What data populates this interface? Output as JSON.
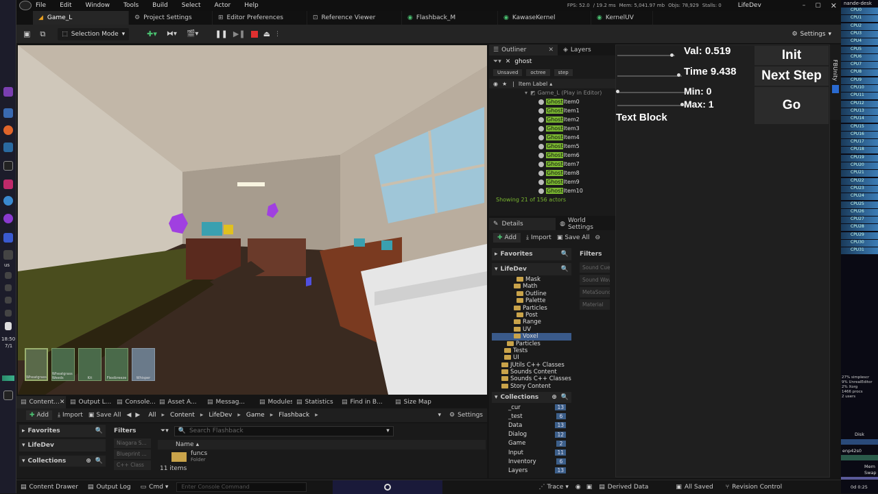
{
  "menu": {
    "items": [
      "File",
      "Edit",
      "Window",
      "Tools",
      "Build",
      "Select",
      "Actor",
      "Help"
    ],
    "stats": {
      "fps": "FPS: 52.0",
      "ms": "/ 19.2 ms",
      "mem": "Mem: 5,041.97 mb",
      "objs": "Objs: 78,929",
      "stalls": "Stalls: 0"
    },
    "project": "LifeDev"
  },
  "tabs": [
    "Game_L",
    "Project Settings",
    "Editor Preferences",
    "Reference Viewer",
    "Flashback_M",
    "KawaseKernel",
    "KernelUV"
  ],
  "toolbar": {
    "selection_mode": "Selection Mode",
    "settings": "Settings"
  },
  "viewport": {
    "inventory_labels": [
      "Wheatgrass",
      "Wheatgrass Weeds",
      "Kit",
      "Flexibreeze",
      "Whisper"
    ]
  },
  "outliner": {
    "title": "Outliner",
    "layers_tab": "Layers",
    "search_value": "ghost",
    "filter_chips": [
      "Unsaved",
      "octree",
      "step"
    ],
    "column": "Item Label",
    "root": "Game_L (Play in Editor)",
    "highlight": "Ghost",
    "items": [
      "Item0",
      "Item1",
      "Item2",
      "Item3",
      "Item4",
      "Item5",
      "Item6",
      "Item7",
      "Item8",
      "Item9",
      "Item10"
    ],
    "status": "Showing 21 of 156 actors"
  },
  "details": {
    "title": "Details",
    "world_settings": "World Settings",
    "add": "Add",
    "import": "Import",
    "save_all": "Save All",
    "favorites": "Favorites",
    "lifedev": "LifeDev",
    "filters": "Filters",
    "filter_items": [
      "Sound Cue",
      "Sound Wave",
      "MetaSound",
      "Material"
    ],
    "folders": [
      "Mask",
      "Math",
      "Outline",
      "Palette",
      "Particles",
      "Post",
      "Range",
      "UV",
      "Voxel",
      "Particles",
      "Tests",
      "UI",
      "JUtils C++ Classes",
      "Sounds Content",
      "Sounds C++ Classes",
      "Story Content"
    ],
    "collections_title": "Collections",
    "collections": [
      {
        "name": "_cur",
        "count": "13"
      },
      {
        "name": "_test",
        "count": "6"
      },
      {
        "name": "Data",
        "count": "13"
      },
      {
        "name": "Dialog",
        "count": "12"
      },
      {
        "name": "Game",
        "count": "2"
      },
      {
        "name": "Input",
        "count": "11"
      },
      {
        "name": "Inventory",
        "count": "6"
      },
      {
        "name": "Layers",
        "count": "13"
      }
    ]
  },
  "widget": {
    "val": "Val: 0.519",
    "time": "Time 9.438",
    "min": "Min: 0",
    "max": "Max: 1",
    "text_block": "Text Block",
    "init": "Init",
    "next_step": "Next Step",
    "go": "Go",
    "side_label": "FBUnity"
  },
  "monitor": {
    "host": "nande-desk",
    "cpus": [
      "CPU0",
      "CPU1",
      "CPU2",
      "CPU3",
      "CPU4",
      "CPU5",
      "CPU6",
      "CPU7",
      "CPU8",
      "CPU9",
      "CPU10",
      "CPU11",
      "CPU12",
      "CPU13",
      "CPU14",
      "CPU15",
      "CPU16",
      "CPU17",
      "CPU18",
      "CPU19",
      "CPU20",
      "CPU21",
      "CPU22",
      "CPU23",
      "CPU24",
      "CPU25",
      "CPU26",
      "CPU27",
      "CPU28",
      "CPU29",
      "CPU30",
      "CPU31"
    ],
    "procs": [
      "27% simplescr",
      "9% UnrealEditor",
      "2% Xorg",
      "1466 procs",
      "2 users"
    ],
    "disk": "Disk",
    "net": "enp42s0",
    "mem": "Mem",
    "swap": "Swap",
    "uptime": "0d 0:25"
  },
  "taskbar": {
    "time": "18:50",
    "date": "7/1",
    "us": "us"
  },
  "content": {
    "tabs": [
      "Content...",
      "Output L...",
      "Console...",
      "Asset A...",
      "Messag...",
      "Modules",
      "Statistics",
      "Find in B...",
      "Size Map"
    ],
    "add": "Add",
    "import": "Import",
    "save_all": "Save All",
    "breadcrumb": [
      "All",
      "Content",
      "LifeDev",
      "Game",
      "Flashback"
    ],
    "settings": "Settings",
    "favorites": "Favorites",
    "lifedev": "LifeDev",
    "collections": "Collections",
    "filters": "Filters",
    "filter_items": [
      "Niagara S...",
      "Blueprint ...",
      "C++ Class"
    ],
    "search_placeholder": "Search Flashback",
    "name_col": "Name",
    "asset_name": "funcs",
    "asset_type": "Folder",
    "count": "11 items"
  },
  "status": {
    "content_drawer": "Content Drawer",
    "output_log": "Output Log",
    "cmd": "Cmd",
    "console_placeholder": "Enter Console Command",
    "trace": "Trace",
    "derived": "Derived Data",
    "all_saved": "All Saved",
    "revision": "Revision Control"
  }
}
